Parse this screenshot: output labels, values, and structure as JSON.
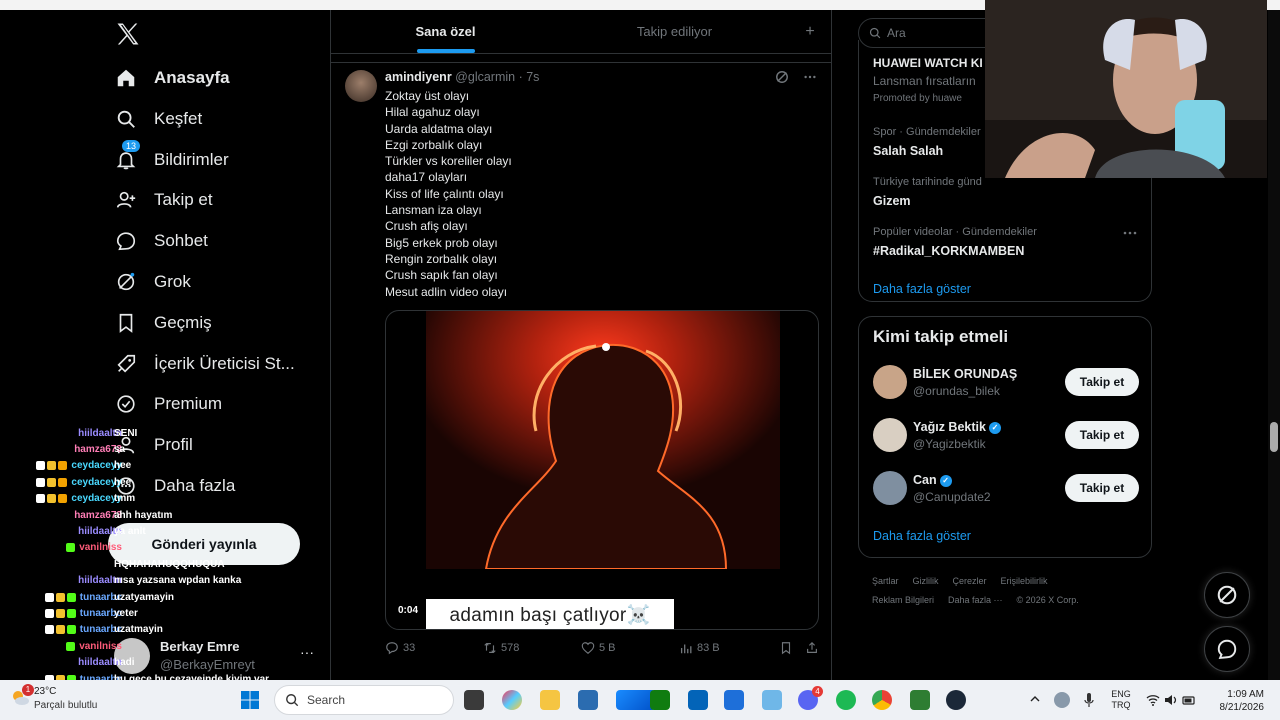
{
  "nav": {
    "items": [
      {
        "label": "Anasayfa",
        "icon": "home-icon"
      },
      {
        "label": "Keşfet",
        "icon": "search-icon"
      },
      {
        "label": "Bildirimler",
        "icon": "bell-icon",
        "badge": "13"
      },
      {
        "label": "Takip et",
        "icon": "person-add-icon"
      },
      {
        "label": "Sohbet",
        "icon": "chat-icon"
      },
      {
        "label": "Grok",
        "icon": "grok-icon"
      },
      {
        "label": "Geçmiş",
        "icon": "bookmark-icon"
      },
      {
        "label": "İçerik Üreticisi St...",
        "icon": "rocket-icon"
      },
      {
        "label": "Premium",
        "icon": "verified-icon"
      },
      {
        "label": "Profil",
        "icon": "profile-icon"
      },
      {
        "label": "Daha fazla",
        "icon": "more-circle-icon"
      }
    ],
    "post_button": "Gönderi yayınla",
    "account": {
      "name": "Berkay Emre",
      "handle": "@BerkayEmreyt",
      "more": "···"
    }
  },
  "chat": [
    {
      "user": "hiildaaltn",
      "color": "#9b8cff",
      "msg": "SENI",
      "icons": []
    },
    {
      "user": "hamza673",
      "color": "#ff7eb6",
      "msg": "sa",
      "icons": []
    },
    {
      "user": "ceydaceyy",
      "color": "#4ad9ff",
      "msg": "hee",
      "icons": [
        "#ffffff",
        "#f2c12e",
        "#f2a200"
      ]
    },
    {
      "user": "ceydaceyy",
      "color": "#4ad9ff",
      "msg": "hee",
      "icons": [
        "#ffffff",
        "#f2c12e",
        "#f2a200"
      ]
    },
    {
      "user": "ceydaceyy",
      "color": "#4ad9ff",
      "msg": "tmm",
      "icons": [
        "#ffffff",
        "#f2c12e",
        "#f2a200"
      ]
    },
    {
      "user": "hamza673",
      "color": "#ff7eb6",
      "msg": "ahh hayatım",
      "icons": []
    },
    {
      "user": "hiildaaltn",
      "color": "#9b8cff",
      "msg": "ya anlt",
      "icons": []
    },
    {
      "user": "vanilniss",
      "color": "#ff5c7a",
      "msg": "",
      "icons": [
        "#53fc18"
      ]
    },
    {
      "user": "",
      "color": "#ffffff",
      "msg": "HQHAHAHUQQHUQUA",
      "icons": []
    },
    {
      "user": "hiildaaltn",
      "color": "#9b8cff",
      "msg": "nısa yazsana wpdan kanka",
      "icons": []
    },
    {
      "user": "tunaarbc",
      "color": "#6aa8ff",
      "msg": "uzatyamayin",
      "icons": [
        "#ffffff",
        "#f2c12e",
        "#53fc18"
      ]
    },
    {
      "user": "tunaarbc",
      "color": "#6aa8ff",
      "msg": "yeter",
      "icons": [
        "#ffffff",
        "#f2c12e",
        "#53fc18"
      ]
    },
    {
      "user": "tunaarbc",
      "color": "#6aa8ff",
      "msg": "uzatmayin",
      "icons": [
        "#ffffff",
        "#f2c12e",
        "#53fc18"
      ]
    },
    {
      "user": "vanilniss",
      "color": "#ff5c7a",
      "msg": "",
      "icons": [
        "#53fc18"
      ]
    },
    {
      "user": "hiildaaltn",
      "color": "#9b8cff",
      "msg": "hadi",
      "icons": []
    },
    {
      "user": "tunaarbc",
      "color": "#6aa8ff",
      "msg": "bu gece bu cezaveinde kiyim var",
      "icons": [
        "#ffffff",
        "#f2c12e",
        "#53fc18"
      ]
    }
  ],
  "feed": {
    "tabs": [
      "Sana özel",
      "Takip ediliyor"
    ],
    "plus": "+",
    "tweet": {
      "name": "amindiyenr",
      "handle": "@glcarmin · 7s",
      "lines": [
        "Zoktay üst olayı",
        "Hilal agahuz olayı",
        "Uarda aldatma olayı",
        "Ezgi zorbalık olayı",
        "Türkler vs koreliler olayı",
        "daha17 olayları",
        "Kiss of life çalıntı olayı",
        "Lansman iza olayı",
        "Crush afiş olayı",
        "Big5 erkek prob olayı",
        "Rengin zorbalık olayı",
        "Crush sapık fan olayı",
        "Mesut adlin video olayı"
      ],
      "video_caption": "adamın başı çatlıyor☠️",
      "video_time": "0:04",
      "actions": {
        "replies": "33",
        "reposts": "578",
        "likes": "5 B",
        "views": "83 B"
      }
    }
  },
  "right": {
    "search_placeholder": "Ara",
    "promo": {
      "title": "HUAWEI WATCH KI",
      "sub": "Lansman fırsatların",
      "promoted": "Promoted by huawe"
    },
    "trends": [
      {
        "context": "Spor · Gündemdekiler",
        "name": "Salah Salah"
      },
      {
        "context": "Türkiye tarihinde günd",
        "name": "Gizem"
      },
      {
        "context": "Popüler videolar · Gündemdekiler",
        "name": "#Radikal_KORKMAMBEN"
      }
    ],
    "trends_more": "Daha fazla göster",
    "who_title": "Kimi takip etmeli",
    "who": [
      {
        "name": "BİLEK ORUNDAŞ",
        "handle": "@orundas_bilek",
        "verified": false,
        "button": "Takip et",
        "avatar_color": "#c8a488"
      },
      {
        "name": "Yağız Bektik",
        "handle": "@Yagizbektik",
        "verified": true,
        "button": "Takip et",
        "avatar_color": "#d9cfc2"
      },
      {
        "name": "Can",
        "handle": "@Canupdate2",
        "verified": true,
        "button": "Takip et",
        "avatar_color": "#7f8fa0"
      }
    ],
    "who_more": "Daha fazla göster",
    "footer": [
      "Şartlar",
      "Gizlilik",
      "Çerezler",
      "Erişilebilirlik",
      "Reklam Bilgileri",
      "Daha fazla ···",
      "© 2026 X Corp."
    ]
  },
  "taskbar": {
    "weather_temp": "23°C",
    "weather_desc": "Parçalı bulutlu",
    "search_label": "Search",
    "lang_top": "ENG",
    "lang_bottom": "TRQ",
    "time": "1:09 AM",
    "date": "8/21/2026",
    "notif_count": "1",
    "discord_badge": "4"
  }
}
